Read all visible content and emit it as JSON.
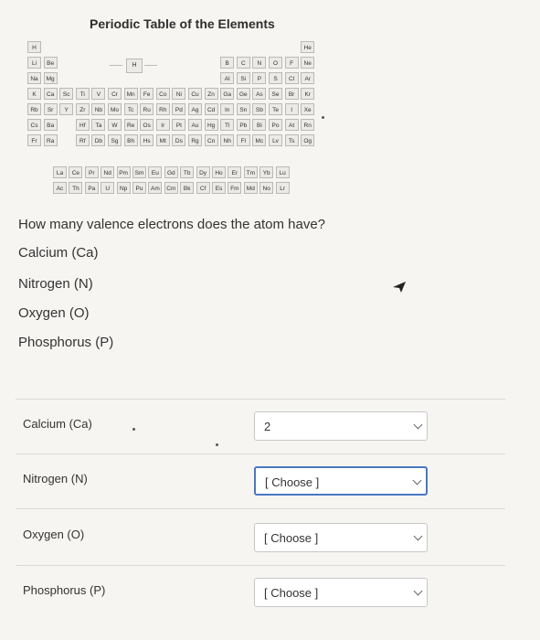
{
  "periodic_table": {
    "title": "Periodic Table of the Elements",
    "legend_symbol": "H",
    "rows": [
      [
        "H",
        "",
        "",
        "",
        "",
        "",
        "",
        "",
        "",
        "",
        "",
        "",
        "",
        "",
        "",
        "",
        "",
        "He"
      ],
      [
        "Li",
        "Be",
        "",
        "",
        "",
        "",
        "",
        "",
        "",
        "",
        "",
        "",
        "B",
        "C",
        "N",
        "O",
        "F",
        "Ne"
      ],
      [
        "Na",
        "Mg",
        "",
        "",
        "",
        "",
        "",
        "",
        "",
        "",
        "",
        "",
        "Al",
        "Si",
        "P",
        "S",
        "Cl",
        "Ar"
      ],
      [
        "K",
        "Ca",
        "Sc",
        "Ti",
        "V",
        "Cr",
        "Mn",
        "Fe",
        "Co",
        "Ni",
        "Cu",
        "Zn",
        "Ga",
        "Ge",
        "As",
        "Se",
        "Br",
        "Kr"
      ],
      [
        "Rb",
        "Sr",
        "Y",
        "Zr",
        "Nb",
        "Mo",
        "Tc",
        "Ru",
        "Rh",
        "Pd",
        "Ag",
        "Cd",
        "In",
        "Sn",
        "Sb",
        "Te",
        "I",
        "Xe"
      ],
      [
        "Cs",
        "Ba",
        "",
        "Hf",
        "Ta",
        "W",
        "Re",
        "Os",
        "Ir",
        "Pt",
        "Au",
        "Hg",
        "Tl",
        "Pb",
        "Bi",
        "Po",
        "At",
        "Rn"
      ],
      [
        "Fr",
        "Ra",
        "",
        "Rf",
        "Db",
        "Sg",
        "Bh",
        "Hs",
        "Mt",
        "Ds",
        "Rg",
        "Cn",
        "Nh",
        "Fl",
        "Mc",
        "Lv",
        "Ts",
        "Og"
      ]
    ],
    "lanthanides": [
      "La",
      "Ce",
      "Pr",
      "Nd",
      "Pm",
      "Sm",
      "Eu",
      "Gd",
      "Tb",
      "Dy",
      "Ho",
      "Er",
      "Tm",
      "Yb",
      "Lu"
    ],
    "actinides": [
      "Ac",
      "Th",
      "Pa",
      "U",
      "Np",
      "Pu",
      "Am",
      "Cm",
      "Bk",
      "Cf",
      "Es",
      "Fm",
      "Md",
      "No",
      "Lr"
    ]
  },
  "question": {
    "prompt": "How many valence electrons does the atom have?",
    "options": [
      "Calcium (Ca)",
      "Nitrogen (N)",
      "Oxygen (O)",
      "Phosphorus (P)"
    ]
  },
  "matches": [
    {
      "label": "Calcium (Ca)",
      "value": "2",
      "chevron_icon": "chevron-down-icon"
    },
    {
      "label": "Nitrogen (N)",
      "value": "[ Choose ]",
      "chevron_icon": "chevron-down-icon"
    },
    {
      "label": "Oxygen (O)",
      "value": "[ Choose ]",
      "chevron_icon": "chevron-down-icon"
    },
    {
      "label": "Phosphorus (P)",
      "value": "[ Choose ]",
      "chevron_icon": "chevron-down-icon"
    }
  ],
  "colors": {
    "focus_border": "#4a78c2"
  }
}
